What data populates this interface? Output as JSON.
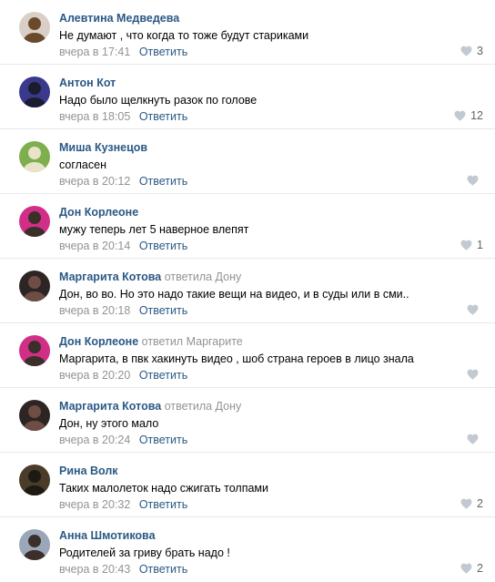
{
  "colors": {
    "author": "#2a5885",
    "muted": "#939393",
    "divider": "#e7e8ec",
    "like_icon": "#c3c9d0"
  },
  "comments": [
    {
      "author": "Алевтина Медведева",
      "reply_to": "",
      "text": "Не думают , что когда то тоже будут стариками",
      "time": "вчера в 17:41",
      "reply_label": "Ответить",
      "likes": "3",
      "avatar_colors": [
        "#d9cfc6",
        "#6b4a2c"
      ]
    },
    {
      "author": "Антон Кот",
      "reply_to": "",
      "text": "Надо было щелкнуть разок по голове",
      "time": "вчера в 18:05",
      "reply_label": "Ответить",
      "likes": "12",
      "avatar_colors": [
        "#3a3a8c",
        "#1c1c30"
      ]
    },
    {
      "author": "Миша Кузнецов",
      "reply_to": "",
      "text": "согласен",
      "time": "вчера в 20:12",
      "reply_label": "Ответить",
      "likes": "",
      "avatar_colors": [
        "#7fae4e",
        "#e9e3c9"
      ]
    },
    {
      "author": "Дон Корлеоне",
      "reply_to": "",
      "text": "мужу теперь лет 5 наверное влепят",
      "time": "вчера в 20:14",
      "reply_label": "Ответить",
      "likes": "1",
      "avatar_colors": [
        "#d12f87",
        "#3b2f2a"
      ]
    },
    {
      "author": "Маргарита Котова",
      "reply_to": "ответила Дону",
      "text": "Дон, во во. Но это надо такие вещи на видео, и в суды или в сми..",
      "time": "вчера в 20:18",
      "reply_label": "Ответить",
      "likes": "",
      "avatar_colors": [
        "#2d2523",
        "#6e4d44"
      ]
    },
    {
      "author": "Дон Корлеоне",
      "reply_to": "ответил Маргарите",
      "text": "Маргарита, в пвк хакинуть видео , шоб страна героев в лицо знала",
      "time": "вчера в 20:20",
      "reply_label": "Ответить",
      "likes": "",
      "avatar_colors": [
        "#d12f87",
        "#3b2f2a"
      ]
    },
    {
      "author": "Маргарита Котова",
      "reply_to": "ответила Дону",
      "text": "Дон, ну этого мало",
      "time": "вчера в 20:24",
      "reply_label": "Ответить",
      "likes": "",
      "avatar_colors": [
        "#2d2523",
        "#6e4d44"
      ]
    },
    {
      "author": "Рина Волк",
      "reply_to": "",
      "text": "Таких малолеток надо сжигать толпами",
      "time": "вчера в 20:32",
      "reply_label": "Ответить",
      "likes": "2",
      "avatar_colors": [
        "#4a3c28",
        "#1d1a14"
      ]
    },
    {
      "author": "Анна Шмотикова",
      "reply_to": "",
      "text": "Родителей за гриву брать надо !",
      "time": "вчера в 20:43",
      "reply_label": "Ответить",
      "likes": "2",
      "avatar_colors": [
        "#9aa7b8",
        "#3c2f29"
      ]
    }
  ]
}
